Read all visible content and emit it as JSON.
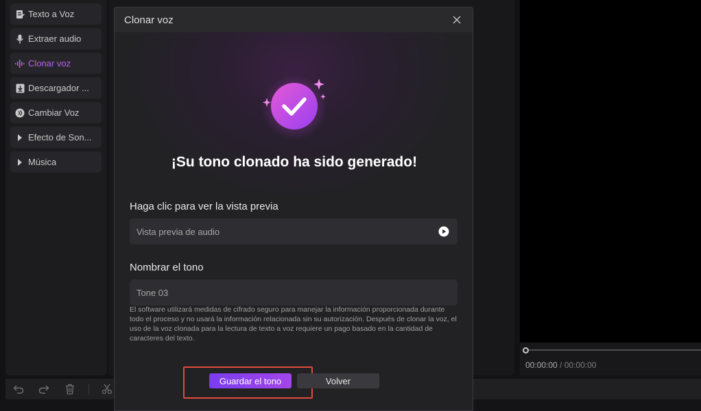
{
  "sidebar": {
    "items": [
      {
        "label": "Texto a Voz",
        "icon": "text-doc-icon"
      },
      {
        "label": "Extraer audio",
        "icon": "microphone-icon"
      },
      {
        "label": "Clonar voz",
        "icon": "waveform-icon",
        "active": true
      },
      {
        "label": "Descargador ...",
        "icon": "download-icon"
      },
      {
        "label": "Cambiar Voz",
        "icon": "voice-change-icon"
      },
      {
        "label": "Efecto de Son...",
        "icon": "caret-right-icon"
      },
      {
        "label": "Música",
        "icon": "caret-right-icon"
      }
    ]
  },
  "player": {
    "current_time": "00:00:00",
    "separator": " / ",
    "total_time": "00:00:00"
  },
  "toolbar": {
    "icons": [
      "undo-icon",
      "redo-icon",
      "trash-icon",
      "scissors-icon"
    ]
  },
  "dialog": {
    "title": "Clonar voz",
    "headline": "¡Su tono clonado ha sido generado!",
    "preview_label": "Haga clic para ver la vista previa",
    "preview_placeholder": "Vista previa de audio",
    "name_label": "Nombrar el tono",
    "name_value": "Tone 03",
    "disclaimer": "El software utilizará medidas de cifrado seguro para manejar la información proporcionada durante todo el proceso y no usará la información relacionada sin su autorización. Después de clonar la voz, el uso de la voz clonada para la lectura de texto a voz requiere un pago basado en la cantidad de caracteres del texto.",
    "save_label": "Guardar el tono",
    "back_label": "Volver"
  },
  "colors": {
    "accent": "#c86bff",
    "save_button_start": "#7a3cf0",
    "save_button_end": "#a445e8",
    "highlight_border": "#e04b3c"
  }
}
